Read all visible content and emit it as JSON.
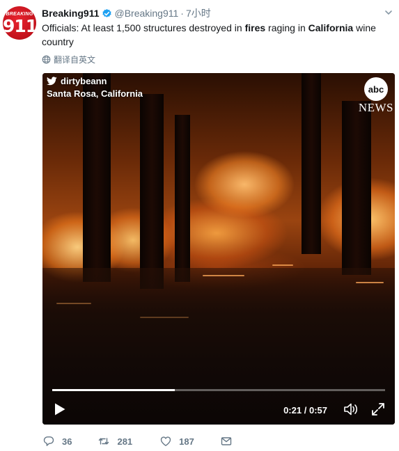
{
  "account": {
    "name": "Breaking911",
    "handle": "@Breaking911",
    "separator": "·",
    "time": "7小时",
    "avatar_small_text": "BREAKING",
    "avatar_number": "911"
  },
  "tweet": {
    "text_parts": [
      {
        "text": "Officials: At least 1,500 structures destroyed in ",
        "bold": false
      },
      {
        "text": "fires",
        "bold": true
      },
      {
        "text": " raging in ",
        "bold": false
      },
      {
        "text": "California",
        "bold": true
      },
      {
        "text": " wine country",
        "bold": false
      }
    ],
    "translate_label": "翻译自英文"
  },
  "video": {
    "source_handle": "dirtybeann",
    "location": "Santa Rosa, California",
    "network_logo": "abc",
    "network_label": "NEWS",
    "current_time": "0:21",
    "separator": "/",
    "duration": "0:57",
    "progress": 0.368
  },
  "actions": {
    "replies": "36",
    "retweets": "281",
    "likes": "187"
  },
  "colors": {
    "accent": "#1da1f2",
    "text_secondary": "#657786",
    "avatar_red": "#d61a24"
  },
  "icons": [
    "verified-badge-icon",
    "caret-down-icon",
    "globe-icon",
    "twitter-bird-icon",
    "play-icon",
    "volume-icon",
    "fullscreen-icon",
    "reply-icon",
    "retweet-icon",
    "like-icon",
    "direct-message-icon"
  ]
}
